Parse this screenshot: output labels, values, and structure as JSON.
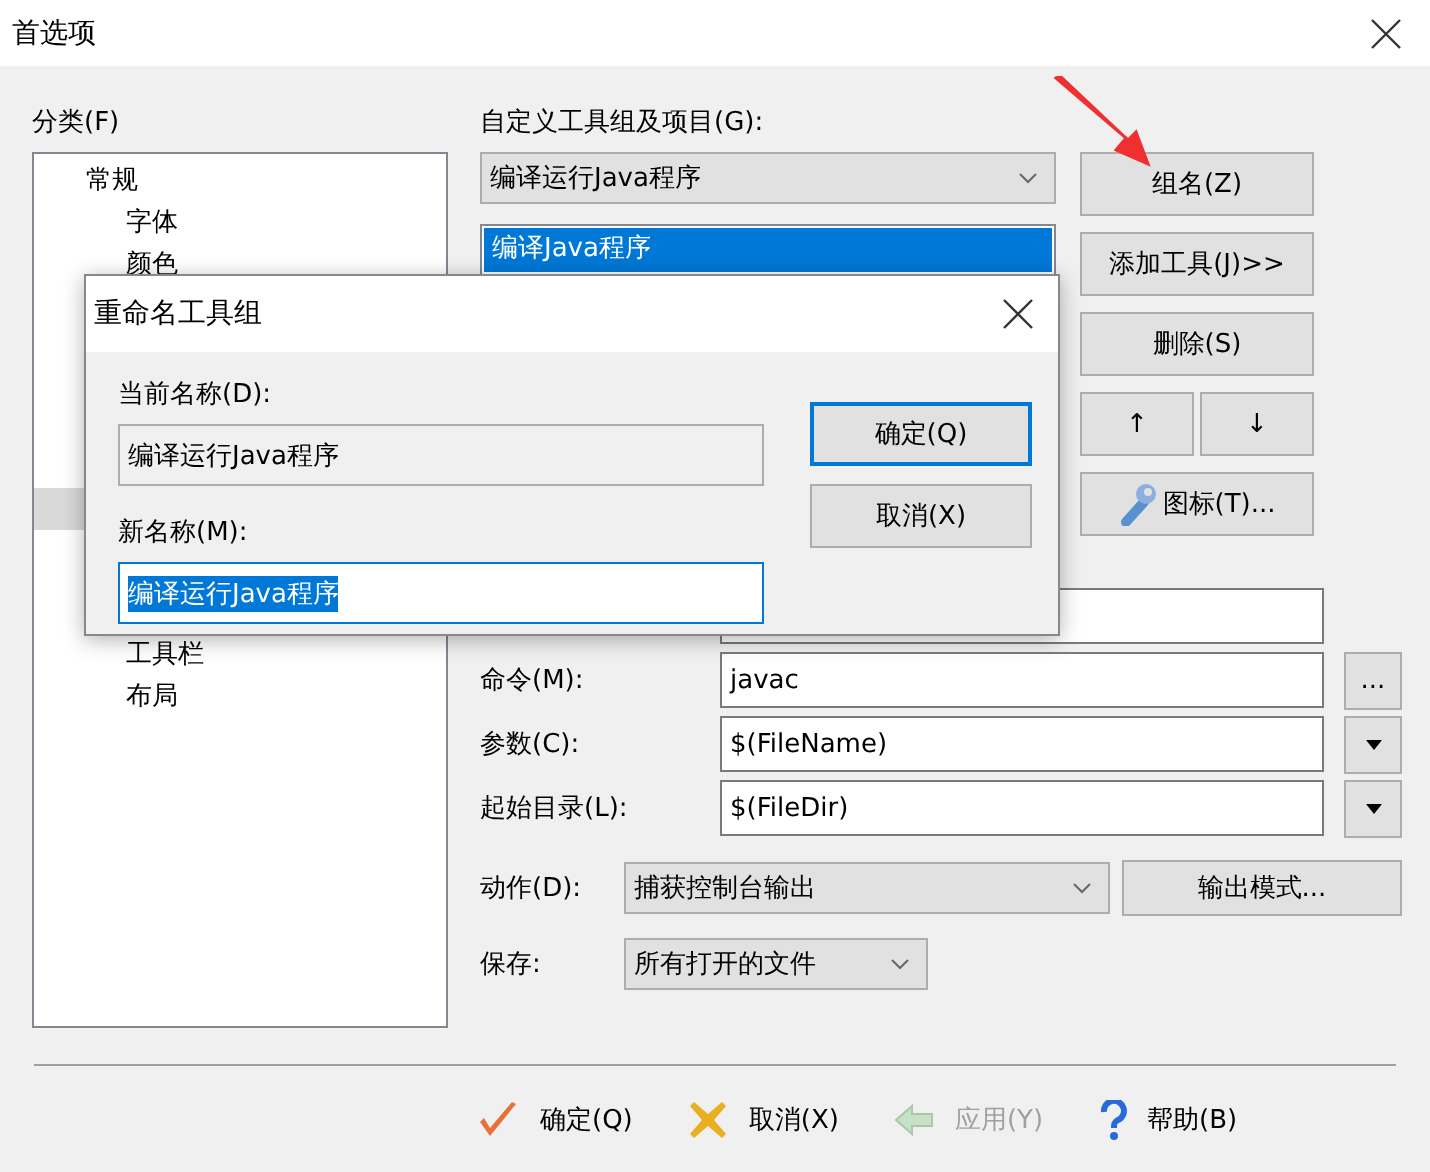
{
  "window": {
    "title": "首选项"
  },
  "category": {
    "label": "分类(F)",
    "tree": [
      {
        "label": "常规",
        "selected": false,
        "children": [
          {
            "label": "字体",
            "selected": false
          },
          {
            "label": "颜色",
            "selected": false
          }
        ]
      },
      {
        "selected": true,
        "children": [
          {
            "label": "工具栏",
            "selected": false
          },
          {
            "label": "布局",
            "selected": false
          }
        ]
      }
    ]
  },
  "tools": {
    "label": "自定义工具组及项目(G):",
    "group": "编译运行Java程序",
    "items": [
      {
        "label": "编译Java程序",
        "selected": true
      }
    ],
    "buttons": [
      {
        "kind": "text",
        "label": "组名(Z)"
      },
      {
        "kind": "text",
        "label": "添加工具(J)>>"
      },
      {
        "kind": "text",
        "label": "删除(S)"
      },
      {
        "kind": "pair",
        "labels": [
          "↑",
          "↓"
        ]
      },
      {
        "kind": "icon",
        "label": "图标(T)..."
      }
    ]
  },
  "form": [
    {
      "kind": "text"
    },
    {
      "kind": "browse",
      "label": "命令(M):",
      "value": "javac",
      "button": "..."
    },
    {
      "kind": "dropdown",
      "label": "参数(C):",
      "value": "$(FileName)"
    },
    {
      "kind": "dropdown",
      "label": "起始目录(L):",
      "value": "$(FileDir)"
    },
    {
      "kind": "select",
      "label": "动作(D):",
      "value": "捕获控制台输出",
      "button": "输出模式..."
    },
    {
      "kind": "select",
      "label": "保存:",
      "value": "所有打开的文件"
    }
  ],
  "footer": [
    {
      "kind": "ok",
      "label": "确定(Q)",
      "disabled": false
    },
    {
      "kind": "cancel",
      "label": "取消(X)",
      "disabled": false
    },
    {
      "kind": "apply",
      "label": "应用(Y)",
      "disabled": true
    },
    {
      "kind": "help",
      "label": "帮助(B)",
      "disabled": false
    }
  ],
  "dialog": {
    "title": "重命名工具组",
    "current_label": "当前名称(D):",
    "current_value": "编译运行Java程序",
    "new_label": "新名称(M):",
    "new_value": "编译运行Java程序",
    "buttons": [
      {
        "label": "确定(Q)",
        "default": true
      },
      {
        "label": "取消(X)",
        "default": false
      }
    ]
  }
}
